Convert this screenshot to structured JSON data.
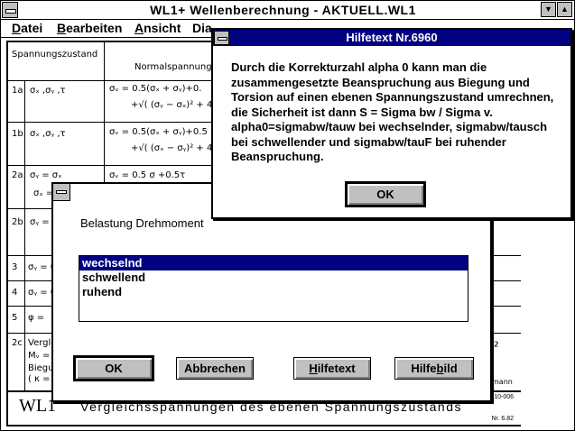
{
  "window": {
    "title": "WL1+    Wellenberechnung  - AKTUELL.WL1",
    "control_up": "▲"
  },
  "menu": {
    "items": [
      {
        "pre": "",
        "u": "D",
        "post": "atei"
      },
      {
        "pre": "",
        "u": "B",
        "post": "earbeiten"
      },
      {
        "pre": "",
        "u": "A",
        "post": "nsicht"
      },
      {
        "pre": "",
        "u": "",
        "post": "Dia"
      }
    ]
  },
  "sheet": {
    "header_col1": "Spannungszustand",
    "header_col2": "Normalspannung",
    "rows": [
      {
        "id": "1a",
        "params": "σₓ ,σᵧ ,τ",
        "formula1": "σᵥ =  0.5(σₓ + σᵧ)+0.",
        "formula2": "+√( (σᵧ − σₓ)² + 4"
      },
      {
        "id": "1b",
        "params": "σₓ ,σᵧ ,τ",
        "formula1": "σᵥ =  0.5(σₓ + σᵧ)+0.5",
        "formula2": "+√( (σₓ − σᵧ)² + 4("
      },
      {
        "id": "2a",
        "params": "σᵧ = σₓ",
        "params2": "σₓ =",
        "formula1": "σᵥ =  0.5 σ +0.5τ",
        "formula2": ""
      },
      {
        "id": "2b",
        "params": "σᵧ =",
        "params2": "σᵥ =",
        "formula1": "",
        "formula2": ""
      },
      {
        "id": "3",
        "params": "σᵧ = 0",
        "formula1": ""
      },
      {
        "id": "4",
        "params": "σᵧ = 0",
        "formula1": ""
      },
      {
        "id": "5",
        "params": "φ =",
        "formula1": ""
      },
      {
        "id": "2c",
        "params": "Vergle",
        "params2": "Mᵥ =",
        "params3": "Biegu",
        "params4": "( κ =",
        "formula1": ""
      }
    ],
    "right_mark": "²",
    "right_word": "mann",
    "footer_logo": "WL1",
    "footer_desc": "Vergleichsspannungen des ebenen Spannungszustands",
    "footer_code1": "10-006",
    "footer_code2": "Nr. 6.82"
  },
  "help_dialog": {
    "title": "Hilfetext Nr.6960",
    "text": "Durch die Korrekturzahl alpha 0 kann man die zusammengesetzte Beanspruchung aus Biegung und Torsion auf einen ebenen Spannungszustand umrechnen, die Sicherheit ist dann S = Sigma bw / Sigma v. alpha0=sigmabw/tauw bei wechselnder, sigmabw/tausch bei schwellender und sigmabw/tauF bei ruhender Beanspruchung.",
    "ok_label": "OK"
  },
  "load_dialog": {
    "label": "Belastung Drehmoment",
    "options": [
      "wechselnd",
      "schwellend",
      "ruhend"
    ],
    "selected_index": 0,
    "buttons": {
      "ok": "OK",
      "cancel": "Abbrechen",
      "help_text_pre": "",
      "help_text_u": "H",
      "help_text_post": "ilfetext",
      "help_image_pre": "Hilfe",
      "help_image_u": "b",
      "help_image_post": "ild"
    }
  }
}
